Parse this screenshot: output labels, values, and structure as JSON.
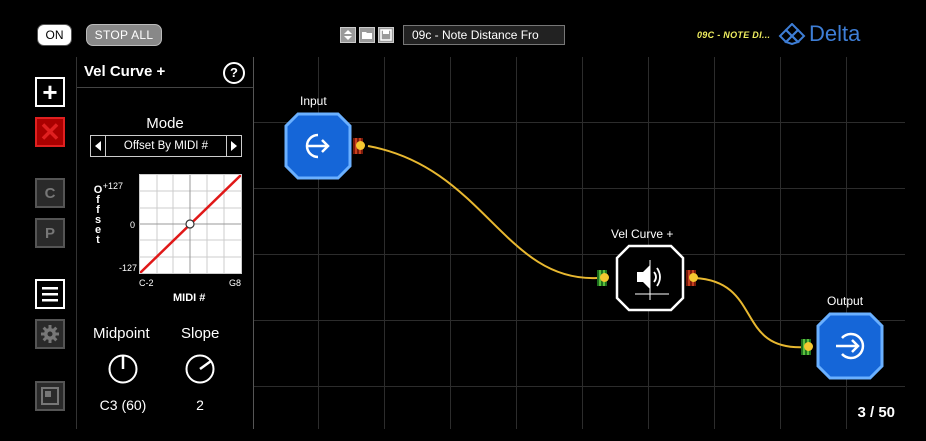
{
  "topbar": {
    "on_label": "ON",
    "stop_all_label": "STOP ALL",
    "preset_name": "09c - Note Distance Fro",
    "preset_tag": "09C - NOTE DI...",
    "brand_name": "Delta"
  },
  "toolbar": {
    "add_label": "+",
    "delete_label": "✕",
    "c_label": "C",
    "p_label": "P"
  },
  "inspector": {
    "title": "Vel Curve +",
    "help_label": "?",
    "mode_label": "Mode",
    "mode_value": "Offset By MIDI #",
    "plot": {
      "y_label": "Offset",
      "y_ticks": [
        "+127",
        "0",
        "-127"
      ],
      "x_ticks": [
        "C-2",
        "G8"
      ],
      "x_label": "MIDI #"
    },
    "knobs": [
      {
        "label": "Midpoint",
        "value": "C3 (60)",
        "level": 0.5
      },
      {
        "label": "Slope",
        "value": "2",
        "level": 0.7
      }
    ]
  },
  "canvas": {
    "nodes": [
      {
        "title": "Input",
        "icon": "input-arrow-icon"
      },
      {
        "title": "Vel Curve +",
        "icon": "velocity-curve-icon"
      },
      {
        "title": "Output",
        "icon": "output-arrow-icon"
      }
    ],
    "module_count": "3 / 50"
  },
  "colors": {
    "node_blue": "#1566d8",
    "wire": "#e8b830",
    "brand_blue": "#3e7ed6",
    "delete_red": "#e02020"
  }
}
